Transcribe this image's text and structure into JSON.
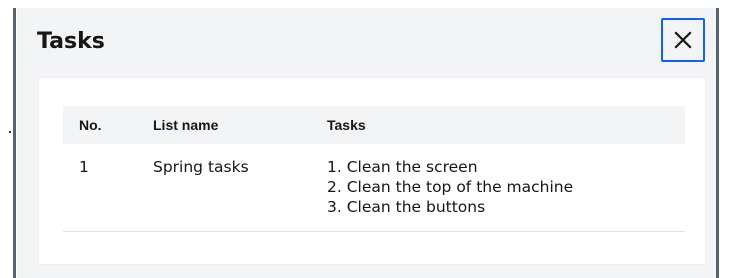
{
  "modal": {
    "title": "Tasks",
    "close_icon": "close-icon"
  },
  "table": {
    "columns": [
      "No.",
      "List name",
      "Tasks"
    ],
    "rows": [
      {
        "no": "1",
        "list_name": "Spring tasks",
        "tasks": [
          "1. Clean the screen",
          "2. Clean the top of the machine",
          "3. Clean the buttons"
        ]
      }
    ]
  },
  "colors": {
    "accent": "#0f62fe",
    "modal_background": "#f3f4f6",
    "card_background": "#ffffff",
    "header_background": "#f3f4f6",
    "text": "#161616"
  }
}
